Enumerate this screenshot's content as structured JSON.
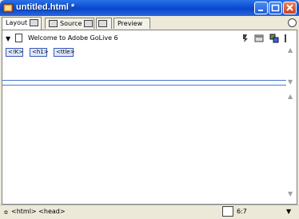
{
  "window": {
    "title": "untitled.html *"
  },
  "tabs": [
    {
      "label": "Layout"
    },
    {
      "label": "Source"
    },
    {
      "label": "Preview"
    }
  ],
  "document": {
    "title": "Welcome to Adobe GoLive 6"
  },
  "tags": [
    "<!K>",
    "<h1>",
    "<ttle>"
  ],
  "status": {
    "path": "<html> <head>",
    "dimensions": "6:7"
  },
  "colors": {
    "titlebar": "#0b4fd8",
    "chrome": "#ece9d8",
    "divider": "#4a79c8"
  }
}
